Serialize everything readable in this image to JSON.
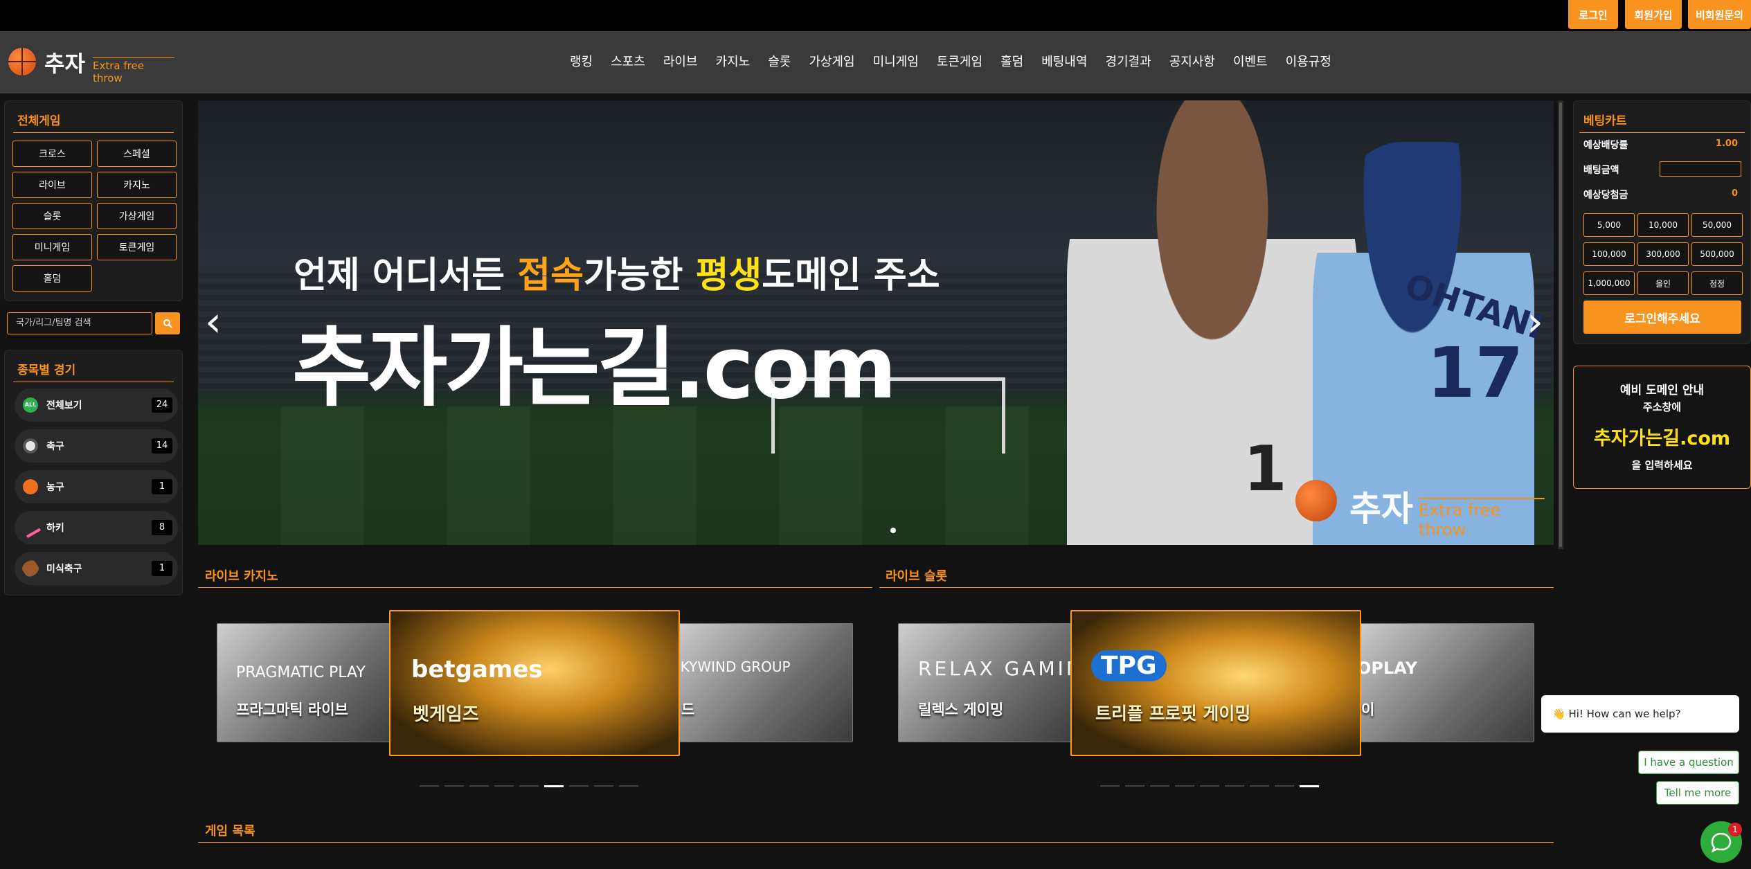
{
  "top": {
    "login": "로그인",
    "signup": "회원가입",
    "guest": "비회원문의"
  },
  "logo": {
    "main": "추자",
    "sub": "Extra free throw"
  },
  "nav": [
    "랭킹",
    "스포츠",
    "라이브",
    "카지노",
    "슬롯",
    "가상게임",
    "미니게임",
    "토큰게임",
    "홀덤",
    "베팅내역",
    "경기결과",
    "공지사항",
    "이벤트",
    "이용규정"
  ],
  "left": {
    "all_games_title": "전체게임",
    "games": [
      "크로스",
      "스페셜",
      "라이브",
      "카지노",
      "슬롯",
      "가상게임",
      "미니게임",
      "토큰게임",
      "홀덤"
    ],
    "search_placeholder": "국가/리그/팀명 검색",
    "sports_title": "종목별 경기",
    "sports": [
      {
        "label": "전체보기",
        "count": "24",
        "icon": "all-icon",
        "color": "#2bb14b"
      },
      {
        "label": "축구",
        "count": "14",
        "icon": "soccer-icon",
        "color": "#e6e6e6"
      },
      {
        "label": "농구",
        "count": "1",
        "icon": "basketball-icon",
        "color": "#f0701e"
      },
      {
        "label": "하키",
        "count": "8",
        "icon": "hockey-icon",
        "color": "#ff5fa2"
      },
      {
        "label": "미식축구",
        "count": "1",
        "icon": "football-icon",
        "color": "#9a5a2e"
      }
    ]
  },
  "banner": {
    "line1_a": "언제 어디서든 ",
    "line1_b": "접속",
    "line1_c": "가능한 ",
    "line1_d": "평생",
    "line1_e": "도메인 주소",
    "line2": "추자가는길.com",
    "player1_num": "1",
    "player2_name": "OHTANI",
    "player2_num": "17",
    "logo_main": "추자",
    "logo_sub": "Extra free throw"
  },
  "sections": {
    "live_casino": "라이브 카지노",
    "live_slot": "라이브 슬롯",
    "game_list": "게임 목록"
  },
  "casino_cards": [
    {
      "title": "PRAGMATIC PLAY",
      "sub": "프라그마틱 라이브"
    },
    {
      "title": "betgames",
      "sub": "벳게임즈"
    },
    {
      "title": "SKYWIND GROUP",
      "sub": "드"
    }
  ],
  "slot_cards": [
    {
      "title": "RELAX GAMING",
      "sub": "릴렉스 게이밍"
    },
    {
      "title": "TPG",
      "sub": "트리플 프로핏 게이밍"
    },
    {
      "title": "OPLAY",
      "sub": "이"
    }
  ],
  "betslip": {
    "title": "베팅카트",
    "expected_odds_label": "예상배당률",
    "expected_odds": "1.00",
    "bet_amount_label": "배팅금액",
    "expected_win_label": "예상당첨금",
    "expected_win": "0",
    "amounts": [
      "5,000",
      "10,000",
      "50,000",
      "100,000",
      "300,000",
      "500,000",
      "1,000,000",
      "올인",
      "정정"
    ],
    "login_cta": "로그인해주세요"
  },
  "domain_notice": {
    "l1": "예비 도메인 안내",
    "l2": "주소창에",
    "l3": "추자가는길.com",
    "l4": "을 입력하세요"
  },
  "chat": {
    "greeting": "👋 Hi! How can we help?",
    "opt1": "I have a question",
    "opt2": "Tell me more",
    "badge": "1"
  },
  "colors": {
    "accent": "#f7931e",
    "highlight": "#ffe11a"
  },
  "pager": {
    "casino_count": 9,
    "casino_active": 6,
    "slot_count": 9,
    "slot_active": 9
  }
}
